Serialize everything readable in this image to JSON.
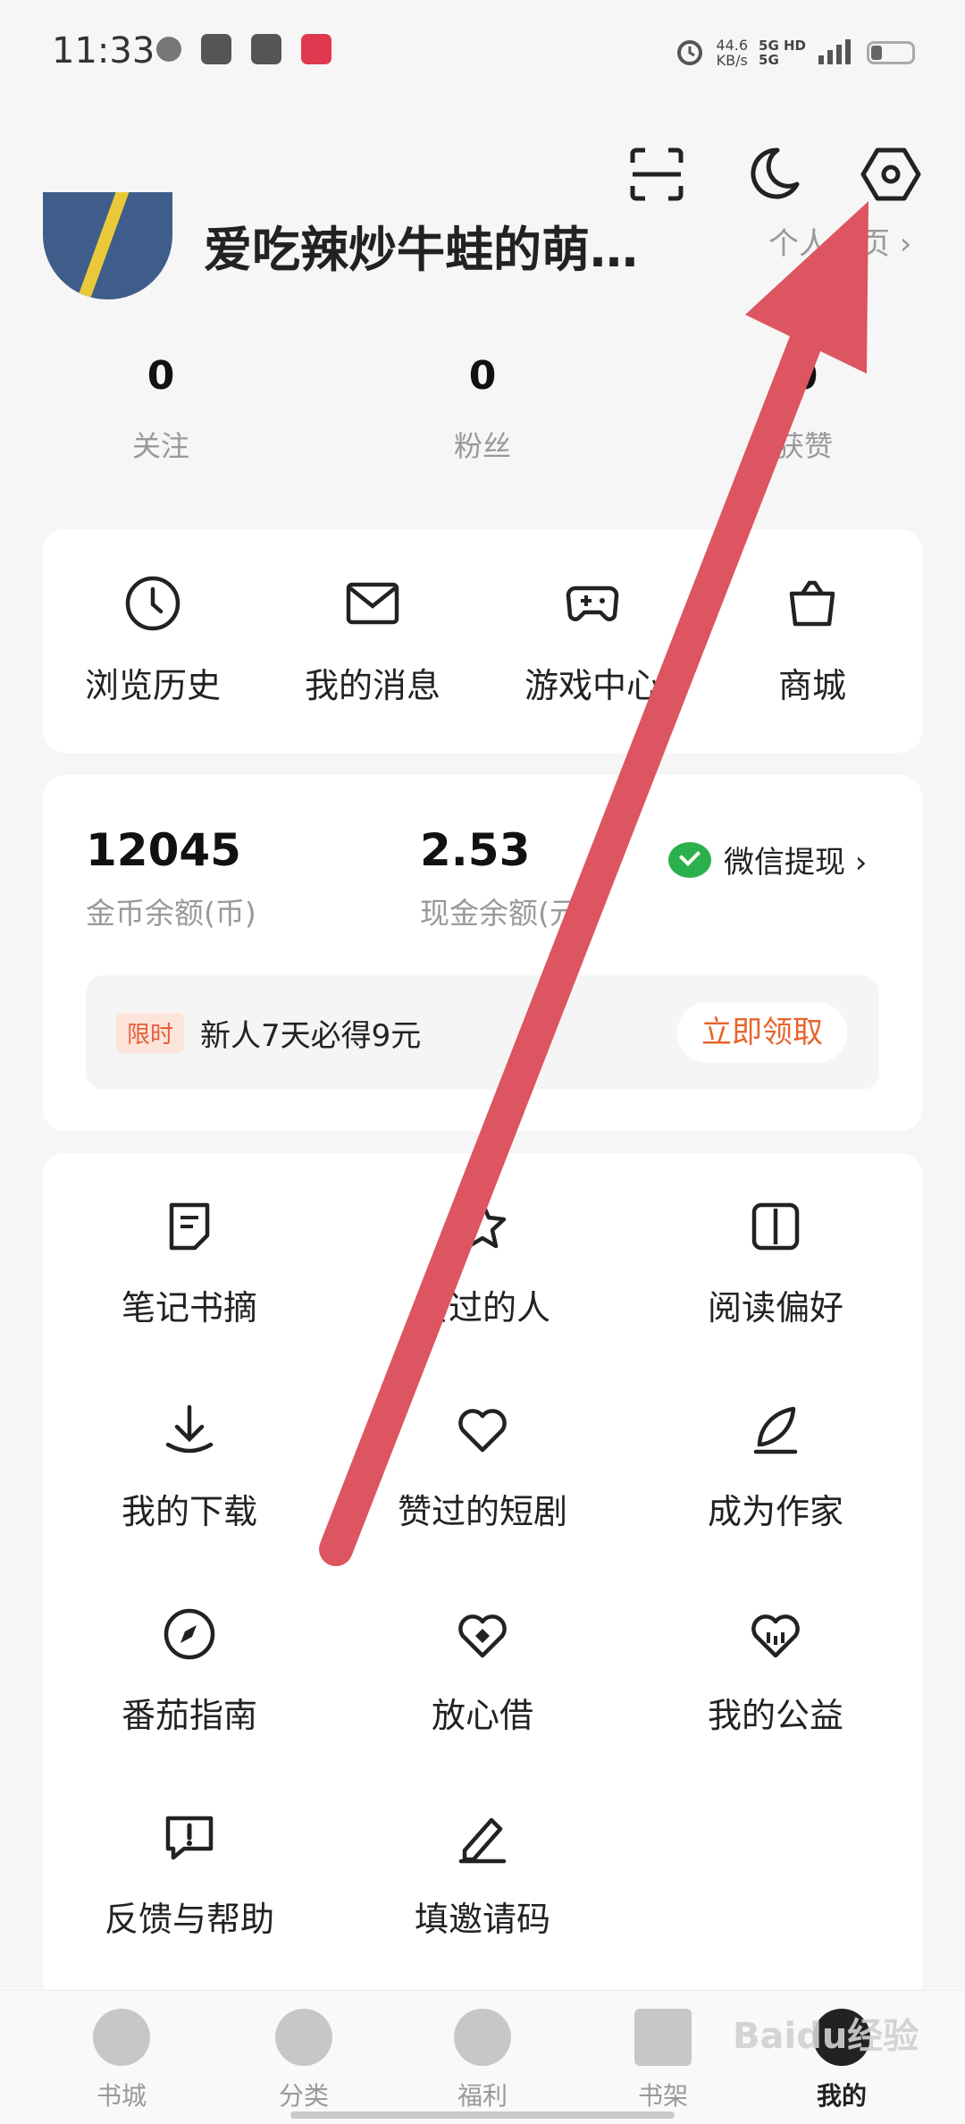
{
  "status_bar": {
    "time": "11:33",
    "net_speed_value": "44.6",
    "net_speed_unit": "KB/s",
    "signal_label_top": "5G HD",
    "signal_label_bottom": "5G"
  },
  "top_actions": [
    {
      "icon": "scan-icon"
    },
    {
      "icon": "moon-icon"
    },
    {
      "icon": "settings-icon"
    }
  ],
  "profile": {
    "username": "爱吃辣炒牛蛙的萌…",
    "homepage_link": "个人主页 ›"
  },
  "stats": [
    {
      "value": "0",
      "label": "关注"
    },
    {
      "value": "0",
      "label": "粉丝"
    },
    {
      "value": "0",
      "label": "获赞"
    }
  ],
  "quick_links": [
    {
      "label": "浏览历史",
      "icon": "clock-icon"
    },
    {
      "label": "我的消息",
      "icon": "mail-icon"
    },
    {
      "label": "游戏中心",
      "icon": "gamepad-icon"
    },
    {
      "label": "商城",
      "icon": "shopping-bag-icon"
    }
  ],
  "wallet": {
    "coins_value": "12045",
    "coins_label": "金币余额(币)",
    "cash_value": "2.53",
    "cash_label": "现金余额(元)",
    "withdraw_label": "微信提现 ›",
    "promo_badge": "限时",
    "promo_text": "新人7天必得9元",
    "promo_button": "立即领取"
  },
  "grid_items": [
    {
      "label": "笔记书摘",
      "icon": "note-icon"
    },
    {
      "label": "赞过的人",
      "icon": "star-icon"
    },
    {
      "label": "阅读偏好",
      "icon": "book-icon"
    },
    {
      "label": "我的下载",
      "icon": "download-icon"
    },
    {
      "label": "赞过的短剧",
      "icon": "heart-icon"
    },
    {
      "label": "成为作家",
      "icon": "quill-icon"
    },
    {
      "label": "番茄指南",
      "icon": "compass-icon"
    },
    {
      "label": "放心借",
      "icon": "double-heart-icon"
    },
    {
      "label": "我的公益",
      "icon": "charity-heart-icon"
    },
    {
      "label": "反馈与帮助",
      "icon": "feedback-icon"
    },
    {
      "label": "填邀请码",
      "icon": "pencil-icon"
    }
  ],
  "bottom_nav": [
    {
      "label": "书城",
      "icon": "bookstore-icon"
    },
    {
      "label": "分类",
      "icon": "category-icon"
    },
    {
      "label": "福利",
      "icon": "welfare-icon"
    },
    {
      "label": "书架",
      "icon": "bookshelf-icon"
    },
    {
      "label": "我的",
      "icon": "profile-icon",
      "active": true
    }
  ],
  "watermark": "Baidu经验",
  "colors": {
    "accent_orange": "#e8642c",
    "wechat_green": "#2bb14b",
    "arrow_red": "#dc5560"
  }
}
